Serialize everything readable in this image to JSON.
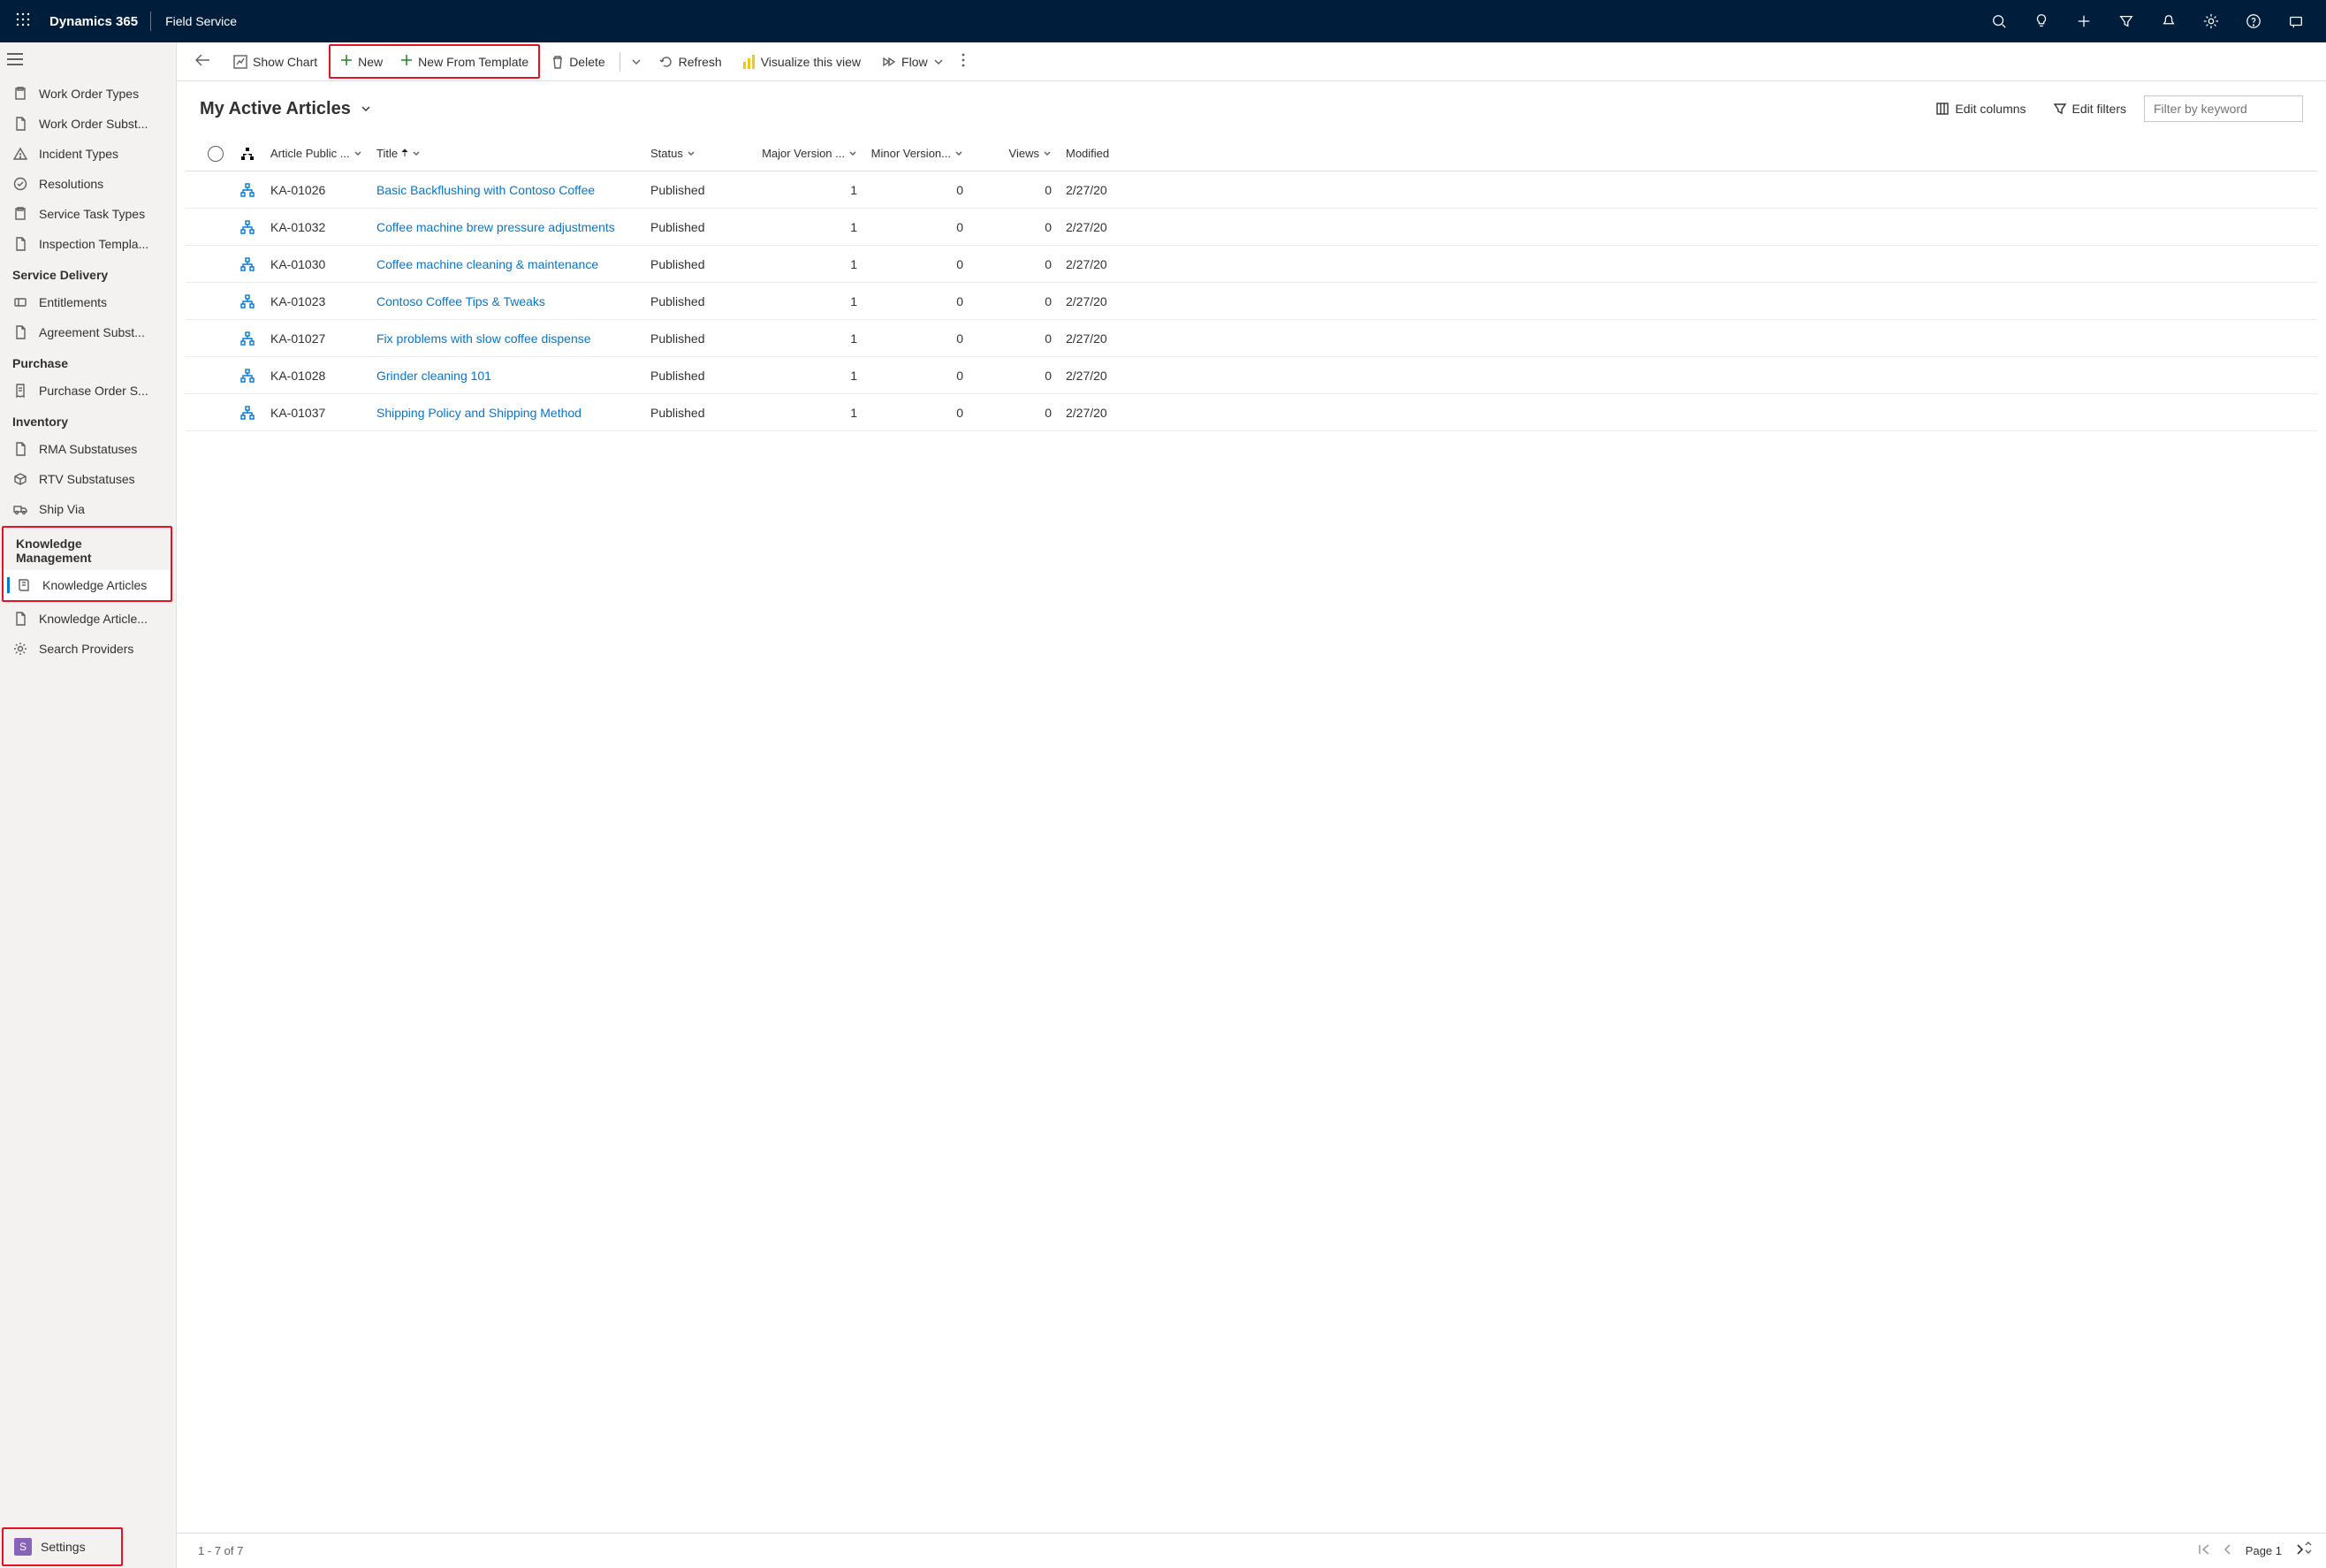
{
  "topbar": {
    "brand": "Dynamics 365",
    "app_name": "Field Service"
  },
  "sidebar": {
    "items_top": [
      {
        "label": "Work Order Types",
        "icon": "clipboard"
      },
      {
        "label": "Work Order Subst...",
        "icon": "doc"
      },
      {
        "label": "Incident Types",
        "icon": "warning"
      },
      {
        "label": "Resolutions",
        "icon": "check-circle"
      },
      {
        "label": "Service Task Types",
        "icon": "clipboard"
      },
      {
        "label": "Inspection Templa...",
        "icon": "doc"
      }
    ],
    "group_service_delivery": "Service Delivery",
    "items_service": [
      {
        "label": "Entitlements",
        "icon": "ticket"
      },
      {
        "label": "Agreement Subst...",
        "icon": "doc"
      }
    ],
    "group_purchase": "Purchase",
    "items_purchase": [
      {
        "label": "Purchase Order S...",
        "icon": "receipt"
      }
    ],
    "group_inventory": "Inventory",
    "items_inventory": [
      {
        "label": "RMA Substatuses",
        "icon": "doc"
      },
      {
        "label": "RTV Substatuses",
        "icon": "box"
      },
      {
        "label": "Ship Via",
        "icon": "truck"
      }
    ],
    "group_knowledge": "Knowledge Management",
    "items_knowledge": [
      {
        "label": "Knowledge Articles",
        "icon": "book",
        "active": true
      },
      {
        "label": "Knowledge Article...",
        "icon": "doc"
      },
      {
        "label": "Search Providers",
        "icon": "gear"
      }
    ],
    "area": {
      "letter": "S",
      "label": "Settings"
    }
  },
  "commandbar": {
    "show_chart": "Show Chart",
    "new": "New",
    "new_from_template": "New From Template",
    "delete": "Delete",
    "refresh": "Refresh",
    "visualize": "Visualize this view",
    "flow": "Flow"
  },
  "view": {
    "title": "My Active Articles",
    "edit_columns": "Edit columns",
    "edit_filters": "Edit filters",
    "filter_placeholder": "Filter by keyword"
  },
  "columns": {
    "article": "Article Public ...",
    "title": "Title",
    "status": "Status",
    "major": "Major Version ...",
    "minor": "Minor Version...",
    "views": "Views",
    "modified": "Modified"
  },
  "rows": [
    {
      "article": "KA-01026",
      "title": "Basic Backflushing with Contoso Coffee",
      "status": "Published",
      "major": "1",
      "minor": "0",
      "views": "0",
      "modified": "2/27/20"
    },
    {
      "article": "KA-01032",
      "title": "Coffee machine brew pressure adjustments",
      "status": "Published",
      "major": "1",
      "minor": "0",
      "views": "0",
      "modified": "2/27/20"
    },
    {
      "article": "KA-01030",
      "title": "Coffee machine cleaning & maintenance",
      "status": "Published",
      "major": "1",
      "minor": "0",
      "views": "0",
      "modified": "2/27/20"
    },
    {
      "article": "KA-01023",
      "title": "Contoso Coffee Tips & Tweaks",
      "status": "Published",
      "major": "1",
      "minor": "0",
      "views": "0",
      "modified": "2/27/20"
    },
    {
      "article": "KA-01027",
      "title": "Fix problems with slow coffee dispense",
      "status": "Published",
      "major": "1",
      "minor": "0",
      "views": "0",
      "modified": "2/27/20"
    },
    {
      "article": "KA-01028",
      "title": "Grinder cleaning 101",
      "status": "Published",
      "major": "1",
      "minor": "0",
      "views": "0",
      "modified": "2/27/20"
    },
    {
      "article": "KA-01037",
      "title": "Shipping Policy and Shipping Method",
      "status": "Published",
      "major": "1",
      "minor": "0",
      "views": "0",
      "modified": "2/27/20"
    }
  ],
  "footer": {
    "range": "1 - 7 of 7",
    "page": "Page 1"
  }
}
